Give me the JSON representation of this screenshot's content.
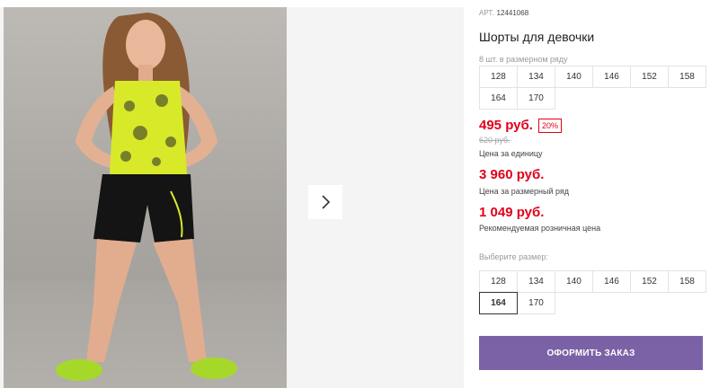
{
  "product": {
    "article_label": "АРТ.",
    "article_value": "12441068",
    "title": "Шорты для девочки"
  },
  "size_row": {
    "hint": "8 шт. в размерном ряду",
    "sizes": [
      "128",
      "134",
      "140",
      "146",
      "152",
      "158",
      "164",
      "170"
    ]
  },
  "pricing": {
    "price": "495 руб.",
    "discount": "20%",
    "old_price": "620 руб.",
    "unit_label": "Цена за единицу",
    "row_price": "3 960 руб.",
    "row_label": "Цена за размерный ряд",
    "retail_price": "1 049 руб.",
    "retail_label": "Рекомендуемая розничная цена"
  },
  "size_select": {
    "hint": "Выберите размер:",
    "sizes": [
      "128",
      "134",
      "140",
      "146",
      "152",
      "158",
      "164",
      "170"
    ],
    "selected": "164"
  },
  "order_button_label": "ОФОРМИТЬ ЗАКАЗ",
  "icons": {
    "next": "chevron-right-icon"
  },
  "colors": {
    "accent": "#7b62a6",
    "price": "#e2001a"
  }
}
